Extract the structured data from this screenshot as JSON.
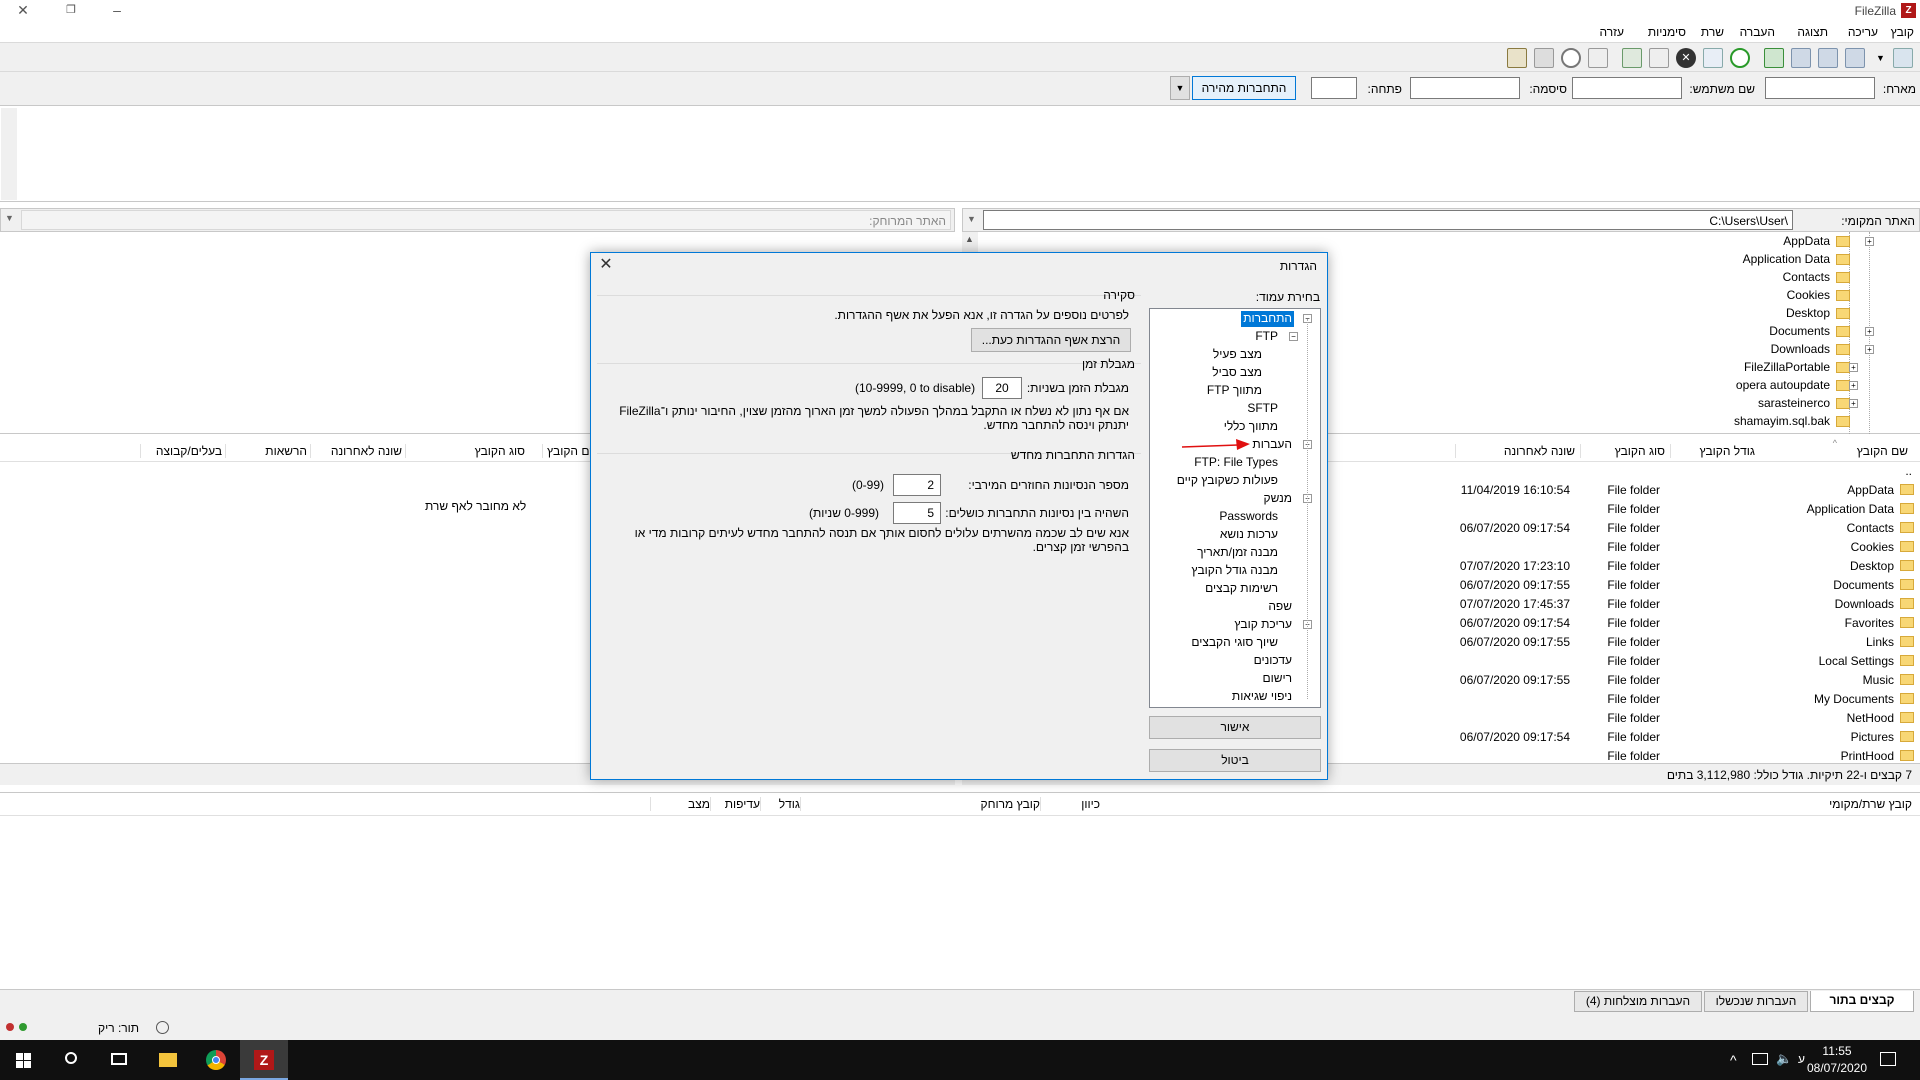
{
  "app": {
    "title": "FileZilla",
    "logo_letter": "Z"
  },
  "menu": [
    "קובץ",
    "עריכה",
    "תצוגה",
    "העברה",
    "שרת",
    "סימניות",
    "עזרה"
  ],
  "quickconnect": {
    "host_label": "מארח:",
    "user_label": "שם משתמש:",
    "password_label": "סיסמה:",
    "port_label": "פתחה:",
    "button_label": "התחברות מהירה",
    "dropdown_arrow": "▼"
  },
  "local_site": {
    "label": "האתר המקומי:",
    "path": "C:\\Users\\User\\"
  },
  "remote_site": {
    "label": "האתר המרוחק:"
  },
  "local_tree": [
    {
      "name": "AppData",
      "expander": "+"
    },
    {
      "name": "Application Data",
      "expander": ""
    },
    {
      "name": "Contacts",
      "expander": ""
    },
    {
      "name": "Cookies",
      "expander": ""
    },
    {
      "name": "Desktop",
      "expander": ""
    },
    {
      "name": "Documents",
      "expander": "+"
    },
    {
      "name": "Downloads",
      "expander": "+"
    },
    {
      "name": "FileZillaPortable",
      "expander": "+"
    },
    {
      "name": "opera autoupdate",
      "expander": "+"
    },
    {
      "name": "sarasteinerco",
      "expander": "+"
    },
    {
      "name": "shamayim.sql.bak",
      "expander": ""
    }
  ],
  "local_list": {
    "headers": {
      "name": "שם הקובץ",
      "size": "גודל הקובץ",
      "type": "סוג הקובץ",
      "modified": "שונה לאחרונה"
    },
    "rows": [
      {
        "name": "..",
        "type": "",
        "modified": ""
      },
      {
        "name": "AppData",
        "type": "File folder",
        "modified": "11/04/2019 16:10:54"
      },
      {
        "name": "Application Data",
        "type": "File folder",
        "modified": ""
      },
      {
        "name": "Contacts",
        "type": "File folder",
        "modified": "06/07/2020 09:17:54"
      },
      {
        "name": "Cookies",
        "type": "File folder",
        "modified": ""
      },
      {
        "name": "Desktop",
        "type": "File folder",
        "modified": "07/07/2020 17:23:10"
      },
      {
        "name": "Documents",
        "type": "File folder",
        "modified": "06/07/2020 09:17:55"
      },
      {
        "name": "Downloads",
        "type": "File folder",
        "modified": "07/07/2020 17:45:37"
      },
      {
        "name": "Favorites",
        "type": "File folder",
        "modified": "06/07/2020 09:17:54"
      },
      {
        "name": "Links",
        "type": "File folder",
        "modified": "06/07/2020 09:17:55"
      },
      {
        "name": "Local Settings",
        "type": "File folder",
        "modified": ""
      },
      {
        "name": "Music",
        "type": "File folder",
        "modified": "06/07/2020 09:17:55"
      },
      {
        "name": "My Documents",
        "type": "File folder",
        "modified": ""
      },
      {
        "name": "NetHood",
        "type": "File folder",
        "modified": ""
      },
      {
        "name": "Pictures",
        "type": "File folder",
        "modified": "06/07/2020 09:17:54"
      },
      {
        "name": "PrintHood",
        "type": "File folder",
        "modified": ""
      }
    ],
    "status": "7 קבצים ו-22 תיקיות. גודל כולל: 3,112,980 בתים"
  },
  "remote_list": {
    "headers": {
      "name": "שם הקובץ",
      "type": "סוג הקובץ",
      "modified": "שונה לאחרונה",
      "perms": "הרשאות",
      "owner": "בעלים/קבוצה"
    },
    "not_connected": "לא מחובר לאף שרת"
  },
  "queue": {
    "headers": {
      "server": "קובץ שרת/מקומי",
      "direction": "כיוון",
      "remote": "קובץ מרוחק",
      "size": "גודל",
      "priority": "עדיפות",
      "status": "מצב"
    },
    "tabs": [
      "קבצים בתור",
      "העברות שנכשלו",
      "העברות מוצלחות (4)"
    ]
  },
  "statusbar": {
    "queue": "תור: ריק"
  },
  "taskbar": {
    "time": "11:55",
    "date": "08/07/2020"
  },
  "dialog": {
    "title": "הגדרות",
    "page_label": "בחירת עמוד:",
    "tree": [
      {
        "label": "התחברות",
        "level": 0,
        "selected": true,
        "expander": "−"
      },
      {
        "label": "FTP",
        "level": 1,
        "expander": "−"
      },
      {
        "label": "מצב פעיל",
        "level": 2
      },
      {
        "label": "מצב סביל",
        "level": 2
      },
      {
        "label": "מתווך FTP",
        "level": 2
      },
      {
        "label": "SFTP",
        "level": 1
      },
      {
        "label": "מתווך כללי",
        "level": 1
      },
      {
        "label": "העברות",
        "level": 0,
        "expander": "−"
      },
      {
        "label": "FTP: File Types",
        "level": 1
      },
      {
        "label": "פעולות כשקובץ קיים",
        "level": 1
      },
      {
        "label": "מנשק",
        "level": 0,
        "expander": "−"
      },
      {
        "label": "Passwords",
        "level": 1
      },
      {
        "label": "ערכות נושא",
        "level": 1
      },
      {
        "label": "מבנה זמן/תאריך",
        "level": 1
      },
      {
        "label": "מבנה גודל הקובץ",
        "level": 1
      },
      {
        "label": "רשימות קבצים",
        "level": 1
      },
      {
        "label": "שפה",
        "level": 0
      },
      {
        "label": "עריכת קובץ",
        "level": 0,
        "expander": "−"
      },
      {
        "label": "שיוך סוגי הקבצים",
        "level": 1
      },
      {
        "label": "עדכונים",
        "level": 0
      },
      {
        "label": "רישום",
        "level": 0
      },
      {
        "label": "ניפוי שגיאות",
        "level": 0
      }
    ],
    "ok_label": "אישור",
    "cancel_label": "ביטול",
    "overview": {
      "title": "סקירה",
      "text": "לפרטים נוספים על הגדרה זו, אנא הפעל את אשף ההגדרות.",
      "wizard_button": "הרצת אשף ההגדרות כעת..."
    },
    "timeout": {
      "title": "מגבלת זמן",
      "label": "מגבלת הזמן בשניות:",
      "value": "20",
      "hint": "(10-9999, 0 to disable)",
      "desc1": "אם אף נתון לא נשלח או התקבל במהלך הפעולה למשך זמן הארוך מהזמן שצוין, החיבור ינותק ו־FileZilla",
      "desc2": "יתנתק וינסה להתחבר מחדש."
    },
    "reconnect": {
      "title": "הגדרות התחברות מחדש",
      "retries_label": "מספר הנסיונות החוזרים המירבי:",
      "retries_value": "2",
      "retries_hint": "(0-99)",
      "delay_label": "השהיה בין נסיונות התחברות כושלים:",
      "delay_value": "5",
      "delay_hint": "(0-999 שניות)",
      "desc1": "אנא שים לב שכמה מהשרתים עלולים לחסום אותך אם תנסה להתחבר מחדש לעיתים קרובות מדי או",
      "desc2": "בהפרשי זמן קצרים."
    }
  },
  "colors": {
    "accent": "#0078d7",
    "folder": "#f8d775",
    "arrow": "#e01010"
  }
}
